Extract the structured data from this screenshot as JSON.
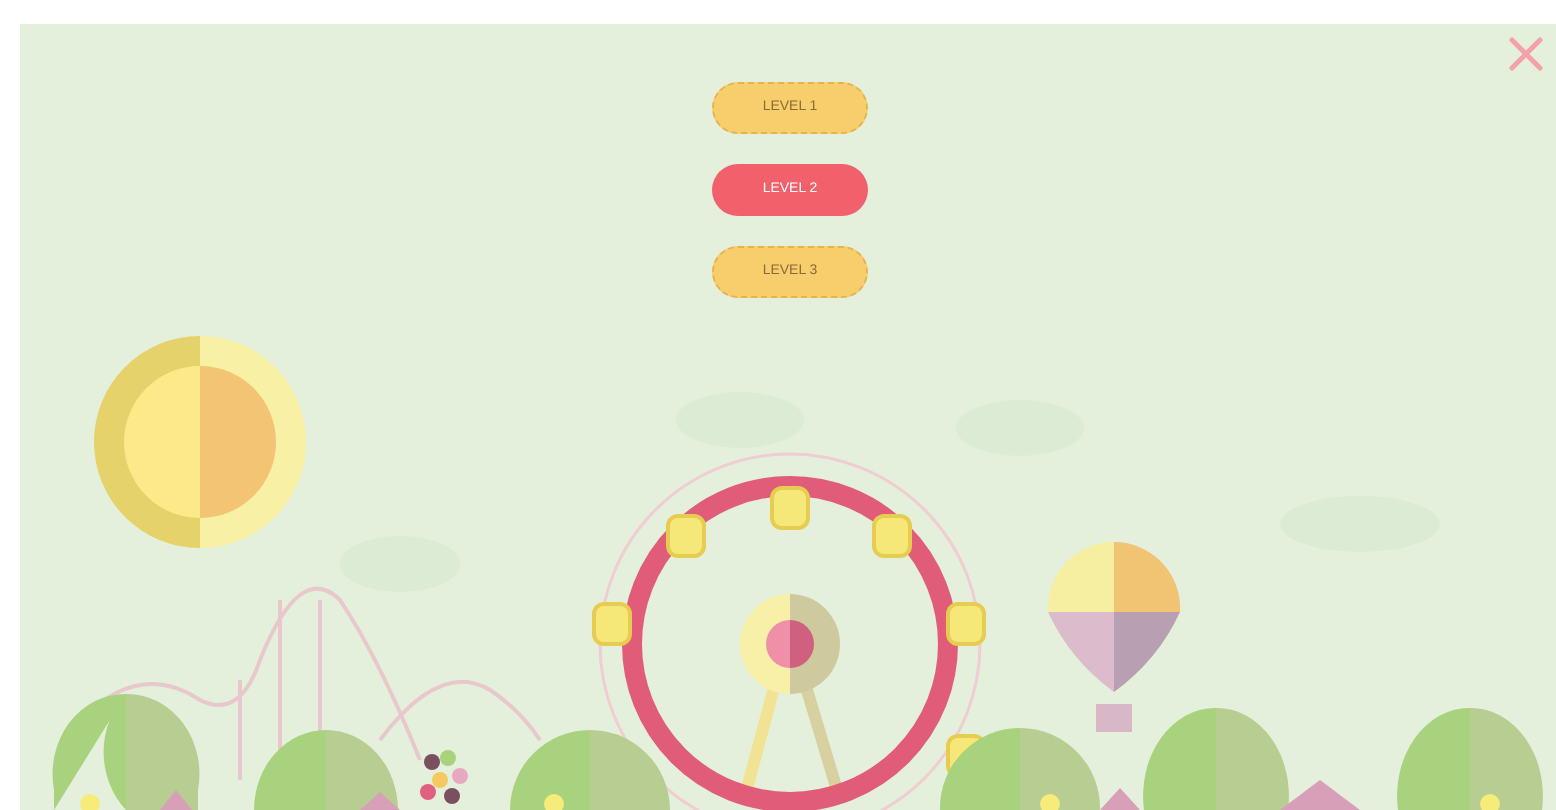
{
  "levels": [
    {
      "label": "LEVEL 1",
      "selected": false
    },
    {
      "label": "LEVEL 2",
      "selected": true
    },
    {
      "label": "LEVEL 3",
      "selected": false
    }
  ]
}
